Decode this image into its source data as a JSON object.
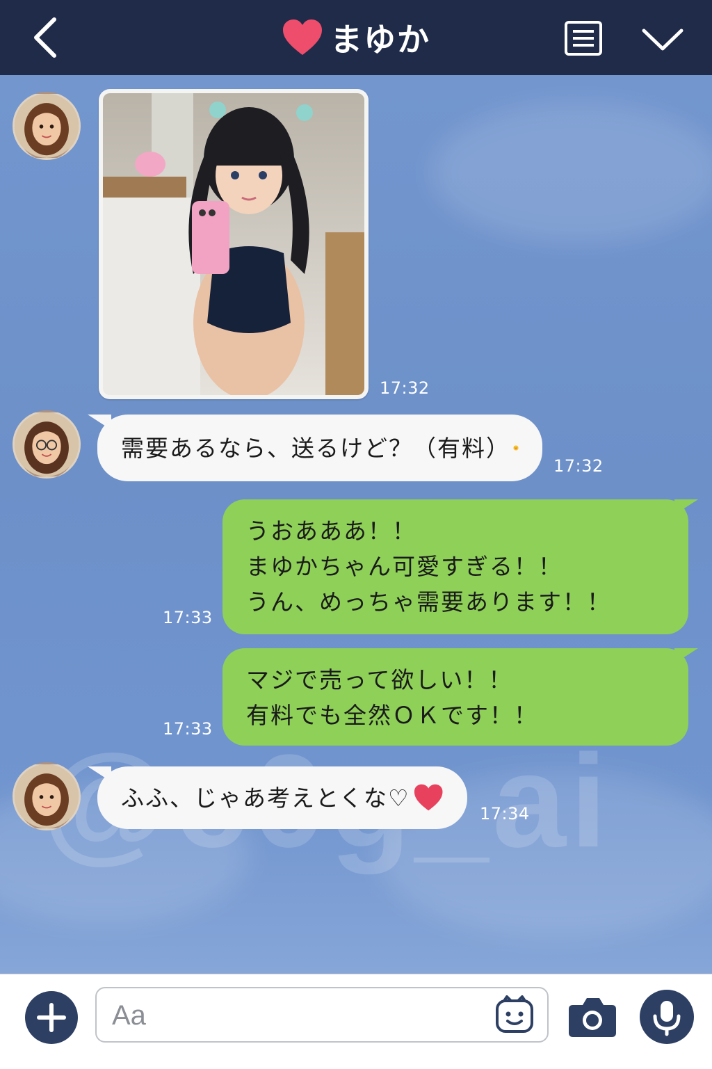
{
  "theme": {
    "header_bg": "#1f2b48",
    "chat_bg": "#6f92cc",
    "incoming_bubble": "#f7f7f7",
    "outgoing_bubble": "#8ed058",
    "heart": "#ee4d6b",
    "icon_dark": "#2d3f63"
  },
  "header": {
    "title": "まゆか",
    "back_icon": "chevron-left-icon",
    "title_icon": "heart-icon",
    "menu_icon": "list-icon",
    "more_icon": "chevron-down-icon"
  },
  "chat": {
    "watermark": "@e0g_ai",
    "messages": [
      {
        "side": "in",
        "type": "image",
        "image_icon": "photo",
        "time": "17:32"
      },
      {
        "side": "in",
        "type": "text",
        "lines": [
          "需要あるなら、送るけど？（有料）"
        ],
        "emoji": "wink-face-icon",
        "time": "17:32"
      },
      {
        "side": "out",
        "type": "text",
        "lines": [
          "うおあああ！！",
          "まゆかちゃん可愛すぎる！！",
          "うん、めっちゃ需要あります！！"
        ],
        "time": "17:33"
      },
      {
        "side": "out",
        "type": "text",
        "lines": [
          "マジで売って欲しい！！",
          "有料でも全然ＯＫです！！"
        ],
        "time": "17:33"
      },
      {
        "side": "in",
        "type": "text",
        "lines": [
          "ふふ、じゃあ考えとくな♡"
        ],
        "emoji": "heart-icon",
        "time": "17:34"
      }
    ]
  },
  "inputbar": {
    "plus_icon": "plus-icon",
    "placeholder": "Aa",
    "sticker_icon": "sticker-face-icon",
    "camera_icon": "camera-icon",
    "mic_icon": "microphone-icon"
  }
}
